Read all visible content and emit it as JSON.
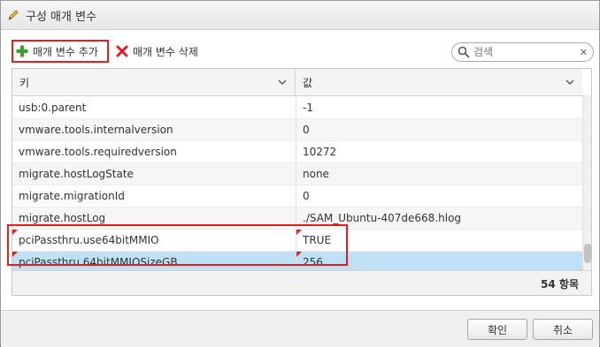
{
  "dialog": {
    "title": "구성 매개 변수",
    "title_icon": "pencil-icon"
  },
  "toolbar": {
    "add_label": "매개 변수 추가",
    "add_icon": "plus-icon",
    "delete_label": "매개 변수 삭제",
    "delete_icon": "x-icon"
  },
  "search": {
    "placeholder": "검색",
    "icon": "search-icon",
    "clear_icon": "close-icon"
  },
  "grid": {
    "columns": [
      "키",
      "값"
    ],
    "rows": [
      {
        "key": "usb:0.parent",
        "value": "-1"
      },
      {
        "key": "vmware.tools.internalversion",
        "value": "0"
      },
      {
        "key": "vmware.tools.requiredversion",
        "value": "10272"
      },
      {
        "key": "migrate.hostLogState",
        "value": "none"
      },
      {
        "key": "migrate.migrationId",
        "value": "0"
      },
      {
        "key": "migrate.hostLog",
        "value": "./SAM_Ubuntu-407de668.hlog"
      },
      {
        "key": "pciPassthru.use64bitMMIO",
        "value": "TRUE"
      },
      {
        "key": "pciPassthru.64bitMMIOSizeGB",
        "value": "256"
      }
    ],
    "count_text": "54 항목"
  },
  "buttons": {
    "ok": "확인",
    "cancel": "취소"
  },
  "colors": {
    "highlight": "#e51d1d",
    "selected_row": "#bfe1f6",
    "add_icon": "#3aa02b"
  }
}
